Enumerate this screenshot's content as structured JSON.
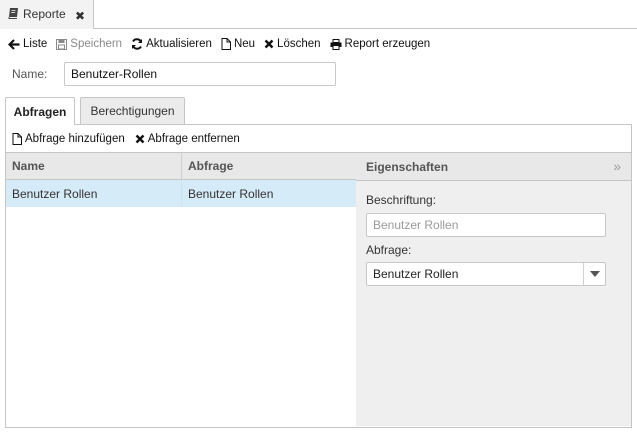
{
  "doc_tab": {
    "label": "Reporte"
  },
  "toolbar": {
    "list": "Liste",
    "save": "Speichern",
    "refresh": "Aktualisieren",
    "new": "Neu",
    "delete": "Löschen",
    "generate": "Report erzeugen"
  },
  "name_field": {
    "label": "Name:",
    "value": "Benutzer-Rollen"
  },
  "subtabs": {
    "active": "Abfragen",
    "inactive": "Berechtigungen"
  },
  "panel_toolbar": {
    "add": "Abfrage hinzufügen",
    "remove": "Abfrage entfernen"
  },
  "grid": {
    "headers": {
      "name": "Name",
      "abfrage": "Abfrage"
    },
    "rows": [
      {
        "name": "Benutzer Rollen",
        "abfrage": "Benutzer Rollen"
      }
    ]
  },
  "properties": {
    "title": "Eigenschaften",
    "caption_label": "Beschriftung:",
    "caption_placeholder": "Benutzer Rollen",
    "query_label": "Abfrage:",
    "query_value": "Benutzer Rollen"
  },
  "colors": {
    "selected_row": "#d6ebf8",
    "header_bg": "#e8e8e8",
    "props_bg": "#efefef"
  }
}
